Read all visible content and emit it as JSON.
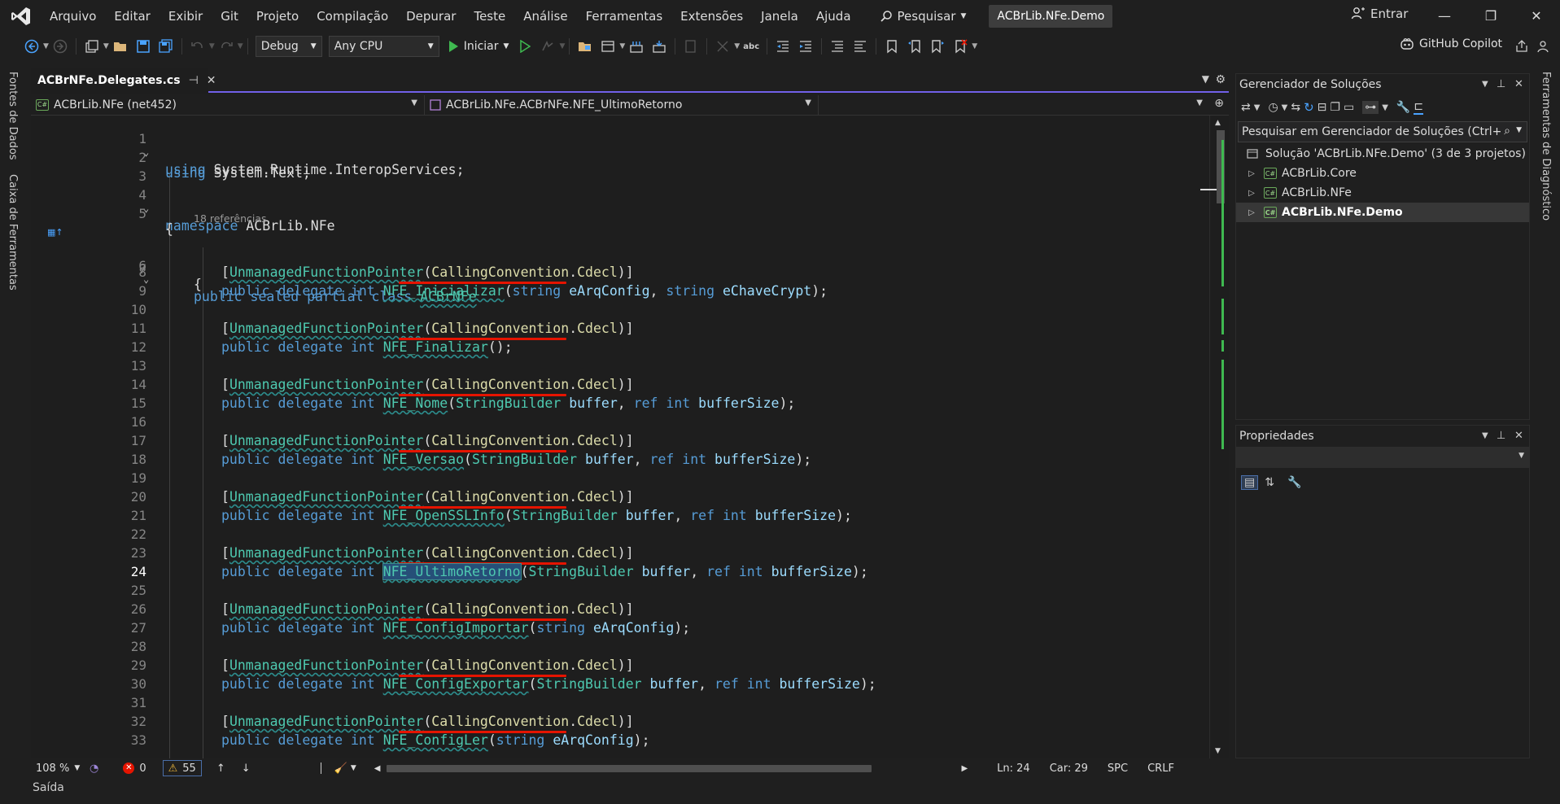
{
  "menu": {
    "items": [
      "Arquivo",
      "Editar",
      "Exibir",
      "Git",
      "Projeto",
      "Compilação",
      "Depurar",
      "Teste",
      "Análise",
      "Ferramentas",
      "Extensões",
      "Janela",
      "Ajuda"
    ],
    "search_label": "Pesquisar",
    "solution_name": "ACBrLib.NFe.Demo",
    "signin_label": "Entrar"
  },
  "toolbar": {
    "config": "Debug",
    "platform": "Any CPU",
    "start_label": "Iniciar",
    "copilot_label": "GitHub Copilot"
  },
  "left_tabs": [
    "Fontes de Dados",
    "Caixa de Ferramentas"
  ],
  "right_tabs": [
    "Ferramentas de Diagnóstico"
  ],
  "editor": {
    "tab_title": "ACBrNFe.Delegates.cs",
    "nav_project": "ACBrLib.NFe (net452)",
    "nav_member": "ACBrLib.NFe.ACBrNFe.NFE_UltimoRetorno",
    "references_hint": "18 referências",
    "zoom": "108 %",
    "errors": "0",
    "warnings": "55",
    "ln": "Ln: 24",
    "col": "Car: 29",
    "spc": "SPC",
    "crlf": "CRLF",
    "current_line": 24
  },
  "code": {
    "using1": [
      "using",
      " System.Runtime.InteropServices;"
    ],
    "using2": [
      "using",
      " System.Text;"
    ],
    "ns": [
      "namespace",
      " ACBrLib.NFe"
    ],
    "brace_open": "{",
    "class_kw": "public sealed partial class",
    "class_name": "ACBrNFe",
    "attr_open": "[",
    "attr_name": "UnmanagedFunctionPointer",
    "attr_arg_type": "CallingConvention",
    "attr_arg_val": "Cdecl",
    "attr_close": ")]",
    "delegate_kw": "public delegate int",
    "delegates": [
      {
        "name": "NFE_Inicializar",
        "params": [
          [
            "string",
            "eArqConfig",
            ", "
          ],
          [
            "string",
            "eChaveCrypt",
            ""
          ]
        ],
        "end": ");"
      },
      {
        "name": "NFE_Finalizar",
        "params": [],
        "end": ");"
      },
      {
        "name": "NFE_Nome",
        "params": [
          [
            "StringBuilder",
            "buffer",
            ", "
          ],
          [
            "ref int",
            "bufferSize",
            ""
          ]
        ],
        "end": ");"
      },
      {
        "name": "NFE_Versao",
        "params": [
          [
            "StringBuilder",
            "buffer",
            ", "
          ],
          [
            "ref int",
            "bufferSize",
            ""
          ]
        ],
        "end": ");"
      },
      {
        "name": "NFE_OpenSSLInfo",
        "params": [
          [
            "StringBuilder",
            "buffer",
            ", "
          ],
          [
            "ref int",
            "bufferSize",
            ""
          ]
        ],
        "end": ");"
      },
      {
        "name": "NFE_UltimoRetorno",
        "params": [
          [
            "StringBuilder",
            "buffer",
            ", "
          ],
          [
            "ref int",
            "bufferSize",
            ""
          ]
        ],
        "end": ");"
      },
      {
        "name": "NFE_ConfigImportar",
        "params": [
          [
            "string",
            "eArqConfig",
            ""
          ]
        ],
        "end": ");"
      },
      {
        "name": "NFE_ConfigExportar",
        "params": [
          [
            "StringBuilder",
            "buffer",
            ", "
          ],
          [
            "ref int",
            "bufferSize",
            ""
          ]
        ],
        "end": ");"
      },
      {
        "name": "NFE_ConfigLer",
        "params": [
          [
            "string",
            "eArqConfig",
            ""
          ]
        ],
        "end": ");"
      }
    ]
  },
  "solution_explorer": {
    "title": "Gerenciador de Soluções",
    "search_placeholder": "Pesquisar em Gerenciador de Soluções (Ctrl+ç)",
    "solution_label": "Solução 'ACBrLib.NFe.Demo' (3 de 3 projetos)",
    "projects": [
      "ACBrLib.Core",
      "ACBrLib.NFe",
      "ACBrLib.NFe.Demo"
    ]
  },
  "properties": {
    "title": "Propriedades"
  },
  "output": {
    "label": "Saída"
  }
}
